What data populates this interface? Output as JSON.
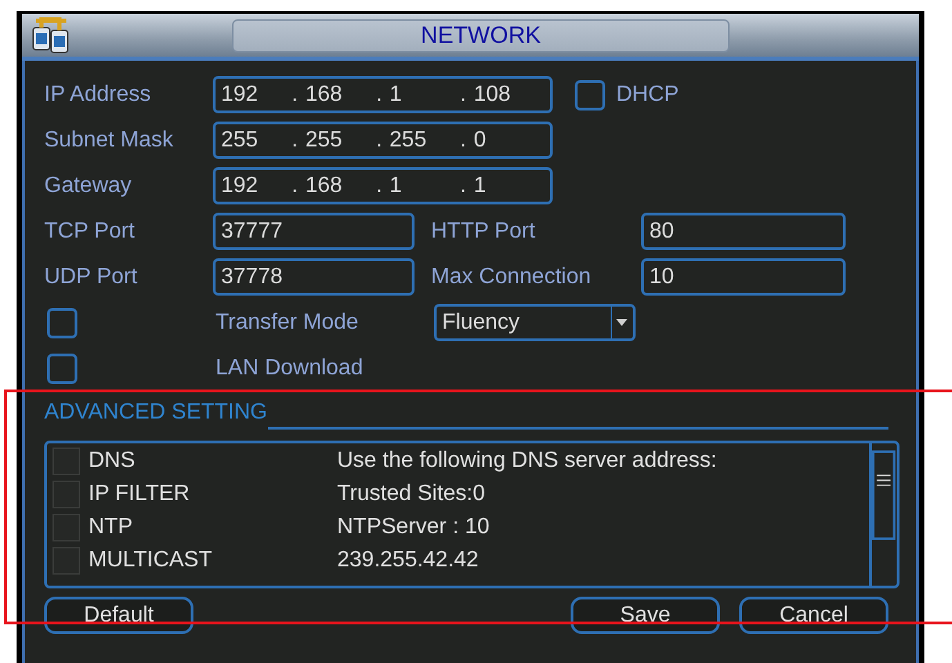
{
  "window": {
    "title": "NETWORK"
  },
  "ip_rows": [
    {
      "label": "IP Address",
      "octets": [
        "192",
        "168",
        "1",
        "108"
      ],
      "separator": "."
    },
    {
      "label": "Subnet Mask",
      "octets": [
        "255",
        "255",
        "255",
        "0"
      ],
      "separator": "."
    },
    {
      "label": "Gateway",
      "octets": [
        "192",
        "168",
        "1",
        "1"
      ],
      "separator": "."
    }
  ],
  "dhcp": {
    "label": "DHCP",
    "checked": false
  },
  "port_rows": [
    {
      "label": "TCP Port",
      "value": "37777",
      "label_2": "HTTP Port",
      "value_2": "80"
    },
    {
      "label": "UDP Port",
      "value": "37778",
      "label_2": "Max Connection",
      "value_2": "10"
    }
  ],
  "transfer_mode": {
    "checked": false,
    "label": "Transfer Mode",
    "value": "Fluency"
  },
  "lan_download": {
    "checked": false,
    "label": "LAN Download"
  },
  "advanced": {
    "title": "ADVANCED SETTING",
    "items": [
      {
        "name": "DNS",
        "detail": "Use the following DNS server address:",
        "checked": false
      },
      {
        "name": "IP FILTER",
        "detail": "Trusted Sites:0",
        "checked": false
      },
      {
        "name": "NTP",
        "detail": "NTPServer : 10",
        "checked": false
      },
      {
        "name": "MULTICAST",
        "detail": "239.255.42.42",
        "checked": false
      }
    ]
  },
  "buttons": [
    {
      "label": "Default",
      "kind": "left"
    },
    {
      "label": "Save",
      "kind": "right"
    },
    {
      "label": "Cancel",
      "kind": "right"
    }
  ]
}
